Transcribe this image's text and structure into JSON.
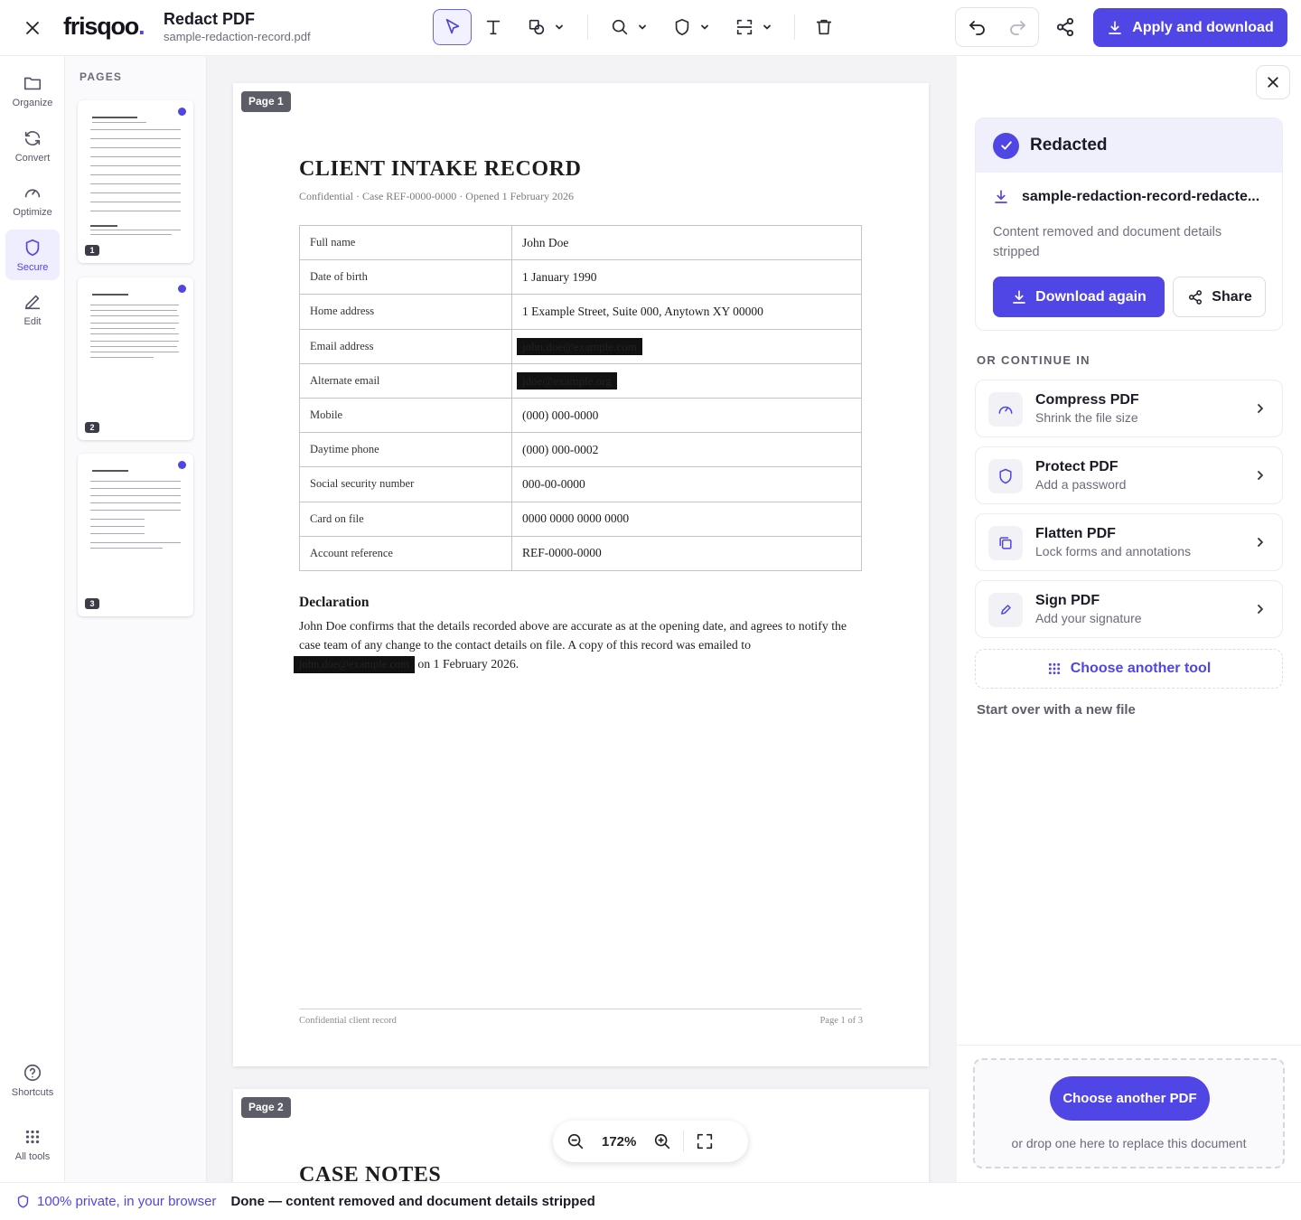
{
  "app": {
    "logo_text": "frisqoo",
    "logo_dot": ".",
    "title": "Redact PDF",
    "file_name": "sample-redaction-record.pdf"
  },
  "toolbar": {
    "tools": [
      "select-tool",
      "text-tool",
      "shape-tool",
      "search-tool",
      "redact-shield-tool",
      "area-select-tool",
      "delete-tool"
    ],
    "apply_label": "Apply and download"
  },
  "rail": {
    "items": [
      {
        "label": "Organize",
        "icon": "folder-icon"
      },
      {
        "label": "Convert",
        "icon": "refresh-icon"
      },
      {
        "label": "Optimize",
        "icon": "gauge-icon"
      },
      {
        "label": "Secure",
        "icon": "shield-icon",
        "active": true
      },
      {
        "label": "Edit",
        "icon": "pencil-icon"
      }
    ],
    "bottom": [
      {
        "label": "Shortcuts",
        "icon": "help-icon"
      },
      {
        "label": "All tools",
        "icon": "grid-icon"
      }
    ]
  },
  "pages_panel": {
    "heading": "PAGES",
    "thumbs": [
      {
        "num": "1"
      },
      {
        "num": "2"
      },
      {
        "num": "3"
      }
    ]
  },
  "document": {
    "page1": {
      "tag": "Page 1",
      "title": "CLIENT INTAKE RECORD",
      "subtitle": "Confidential  ·  Case REF-0000-0000  ·  Opened 1 February 2026",
      "rows": [
        {
          "k": "Full name",
          "v": "John Doe"
        },
        {
          "k": "Date of birth",
          "v": "1 January 1990"
        },
        {
          "k": "Home address",
          "v": "1 Example Street, Suite 000, Anytown XY 00000"
        },
        {
          "k": "Email address",
          "v": "john.doe@example.com",
          "redacted": true
        },
        {
          "k": "Alternate email",
          "v": "jdoe@example.org",
          "redacted": true
        },
        {
          "k": "Mobile",
          "v": "(000) 000-0000"
        },
        {
          "k": "Daytime phone",
          "v": "(000) 000-0002"
        },
        {
          "k": "Social security number",
          "v": "000-00-0000"
        },
        {
          "k": "Card on file",
          "v": "0000 0000 0000 0000"
        },
        {
          "k": "Account reference",
          "v": "REF-0000-0000"
        }
      ],
      "declaration_heading": "Declaration",
      "declaration_text": "John Doe confirms that the details recorded above are accurate as at the opening date, and agrees to notify the case team of any change to the contact details on file. A copy of this record was emailed to",
      "declaration_redacted": "john.doe@example.com",
      "declaration_tail": " on 1 February 2026.",
      "footer_left": "Confidential client record",
      "footer_right": "Page 1 of 3"
    },
    "page2": {
      "tag": "Page 2",
      "title": "CASE NOTES"
    },
    "zoom": "172%"
  },
  "right_panel": {
    "status_title": "Redacted",
    "download_file": "sample-redaction-record-redacte...",
    "description": "Content removed and document details stripped",
    "download_again": "Download again",
    "share": "Share",
    "continue_heading": "OR CONTINUE IN",
    "tools": [
      {
        "name": "Compress PDF",
        "desc": "Shrink the file size",
        "icon": "gauge-icon"
      },
      {
        "name": "Protect PDF",
        "desc": "Add a password",
        "icon": "shield-icon"
      },
      {
        "name": "Flatten PDF",
        "desc": "Lock forms and annotations",
        "icon": "layers-icon"
      },
      {
        "name": "Sign PDF",
        "desc": "Add your signature",
        "icon": "pen-icon"
      }
    ],
    "choose_tool": "Choose another tool",
    "start_over": "Start over with a new file",
    "choose_pdf": "Choose another PDF",
    "drop_text": "or drop one here to replace this document"
  },
  "status_bar": {
    "privacy": "100% private, in your browser",
    "message": "Done — content removed and document details stripped"
  },
  "colors": {
    "accent": "#4f46e5",
    "redaction": "#111111"
  }
}
